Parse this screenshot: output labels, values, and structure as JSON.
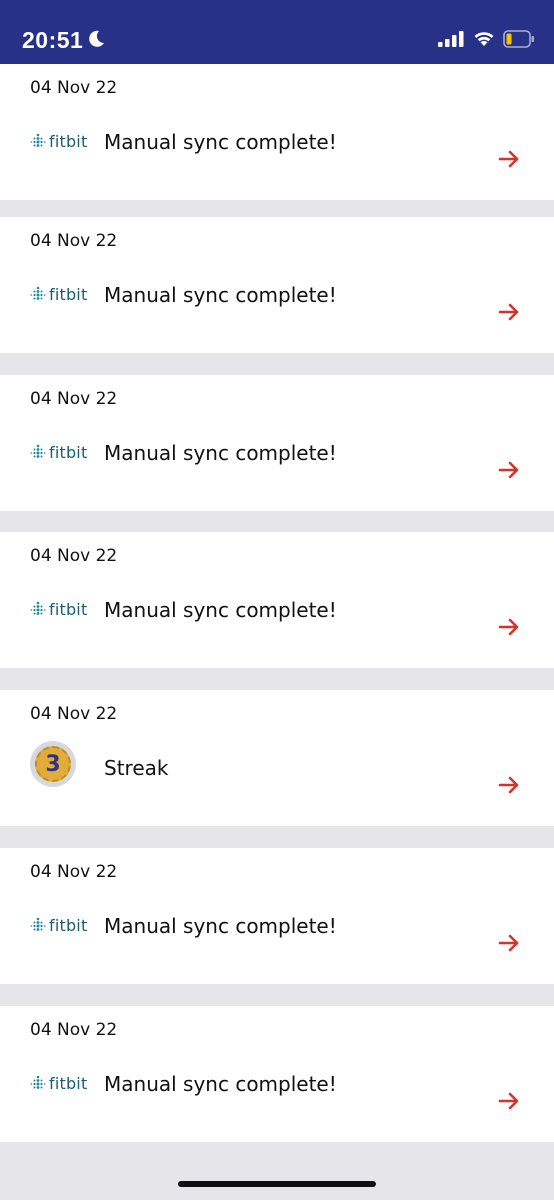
{
  "status_bar": {
    "time": "20:51",
    "background": "#283188"
  },
  "feed": {
    "items": [
      {
        "date": "04 Nov 22",
        "icon": "fitbit-logo",
        "brand": "fitbit",
        "title": "Manual sync complete!"
      },
      {
        "date": "04 Nov 22",
        "icon": "fitbit-logo",
        "brand": "fitbit",
        "title": "Manual sync complete!"
      },
      {
        "date": "04 Nov 22",
        "icon": "fitbit-logo",
        "brand": "fitbit",
        "title": "Manual sync complete!"
      },
      {
        "date": "04 Nov 22",
        "icon": "fitbit-logo",
        "brand": "fitbit",
        "title": "Manual sync complete!"
      },
      {
        "date": "04 Nov 22",
        "icon": "streak-badge",
        "badge_number": "3",
        "title": "Streak"
      },
      {
        "date": "04 Nov 22",
        "icon": "fitbit-logo",
        "brand": "fitbit",
        "title": "Manual sync complete!"
      },
      {
        "date": "04 Nov 22",
        "icon": "fitbit-logo",
        "brand": "fitbit",
        "title": "Manual sync complete!"
      }
    ]
  },
  "colors": {
    "accent_arrow": "#d0352b",
    "separator": "#e6e6ea",
    "fitbit_teal": "#1a5e74"
  }
}
